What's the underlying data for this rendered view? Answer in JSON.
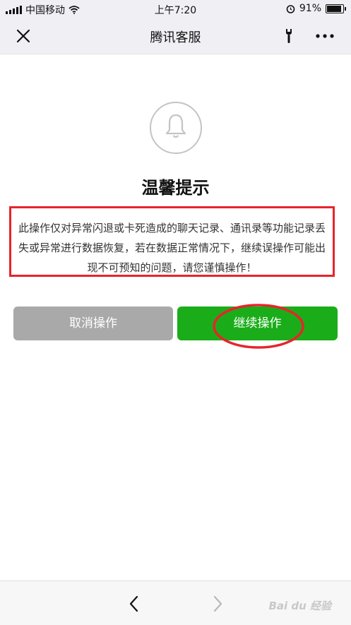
{
  "status_bar": {
    "carrier": "中国移动",
    "time": "上午7:20",
    "battery_text": "91%",
    "battery_level": 0.91
  },
  "nav": {
    "title": "腾讯客服",
    "close_icon": "close-icon",
    "tool_icon": "wrench-icon",
    "more_icon": "more-dots-icon"
  },
  "dialog": {
    "icon": "bell-icon",
    "title": "温馨提示",
    "message": "此操作仅对异常闪退或卡死造成的聊天记录、通讯录等功能记录丢失或异常进行数据恢复，若在数据正常情况下，继续误操作可能出现不可预知的问题，请您谨慎操作！",
    "cancel_label": "取消操作",
    "continue_label": "继续操作"
  },
  "bottom_bar": {
    "back_icon": "chevron-left-icon",
    "forward_icon": "chevron-right-icon",
    "watermark": "Bai du 经验"
  },
  "colors": {
    "nav_background": "#efeff4",
    "primary_green": "#1aad19",
    "cancel_gray": "#a9a9a9",
    "annotation_red": "#e8242c"
  }
}
